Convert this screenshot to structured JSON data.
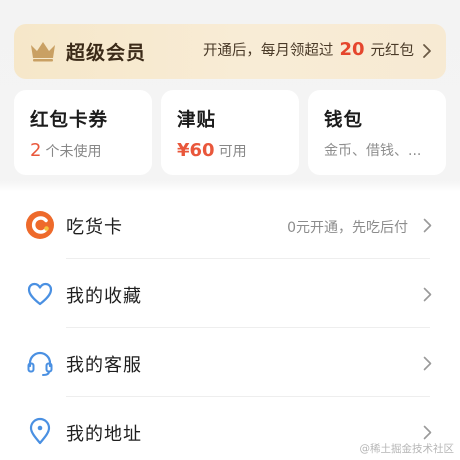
{
  "vip": {
    "title": "超级会员",
    "promo_prefix": "开通后，每月领超过",
    "promo_amount": "20",
    "promo_suffix": "元红包"
  },
  "cards": [
    {
      "title": "红包卡券",
      "highlight": "2",
      "sub": "个未使用"
    },
    {
      "title": "津贴",
      "highlight": "¥60",
      "sub": "可用"
    },
    {
      "title": "钱包",
      "sub": "金币、借钱、..."
    }
  ],
  "list": [
    {
      "label": "吃货卡",
      "right": "0元开通，先吃后付",
      "icon": "chihuo-card-icon"
    },
    {
      "label": "我的收藏",
      "icon": "heart-icon"
    },
    {
      "label": "我的客服",
      "icon": "headset-icon"
    },
    {
      "label": "我的地址",
      "icon": "location-pin-icon"
    }
  ],
  "watermark": "@稀土掘金技术社区",
  "colors": {
    "accent_red": "#e9573b",
    "vip_bg": "#f6e7c9",
    "icon_blue": "#4a90e2",
    "crown_gold": "#c9a063",
    "chihuo_orange": "#ee6a2b"
  }
}
